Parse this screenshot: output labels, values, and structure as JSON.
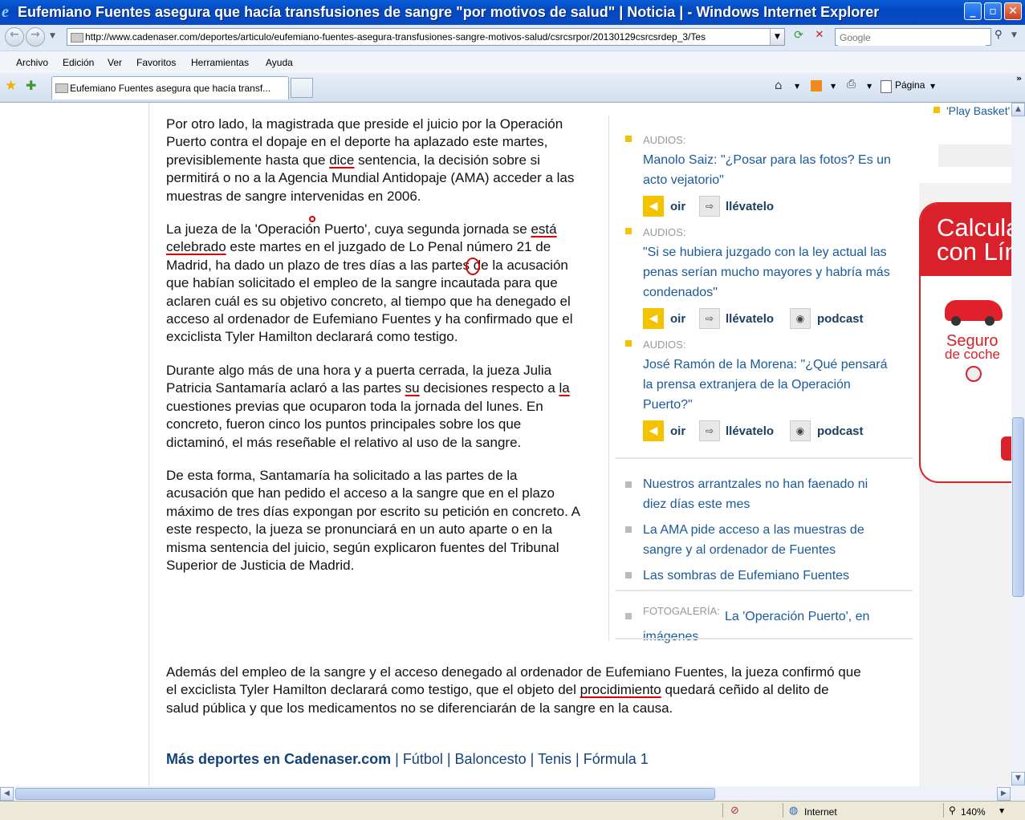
{
  "window": {
    "title": "Eufemiano Fuentes asegura que hacía transfusiones de sangre \"por motivos de salud\" | Noticia |  - Windows Internet Explorer"
  },
  "address_bar": {
    "url": "http://www.cadenaser.com/deportes/articulo/eufemiano-fuentes-asegura-transfusiones-sangre-motivos-salud/csrcsrpor/20130129csrcsrdep_3/Tes",
    "search_placeholder": "Google"
  },
  "menu": [
    "Archivo",
    "Edición",
    "Ver",
    "Favoritos",
    "Herramientas",
    "Ayuda"
  ],
  "tab": {
    "label": "Eufemiano Fuentes asegura que hacía transf..."
  },
  "toolbar": {
    "page_label": "Página"
  },
  "article": {
    "p1": "Por otro lado, la magistrada que preside el juicio por la Operación Puerto contra el dopaje en el deporte ha aplazado este martes, previsiblemente hasta que dice sentencia, la decisión sobre si permitirá o no a la Agencia Mundial Antidopaje (AMA) acceder a las muestras de sangre intervenidas en 2006.",
    "p2": "La jueza de la 'Operación Puerto', cuya segunda jornada se está celebrado este martes en el juzgado de Lo Penal número 21 de Madrid, ha dado un plazo de tres días a las partes de la acusación que habían solicitado el empleo de la sangre incautada para que aclaren cuál es su objetivo concreto, al tiempo que ha denegado el acceso al ordenador de Eufemiano Fuentes y ha confirmado que el exciclista Tyler Hamilton declarará como testigo.",
    "p3": "Durante algo más de una hora y a puerta cerrada, la jueza Julia Patricia Santamaría aclaró a las partes su decisiones respecto a la cuestiones previas que ocuparon toda la jornada del lunes. En concreto, fueron cinco los puntos principales sobre los que dictaminó, el más reseñable el relativo al uso de la sangre.",
    "p4": "De esta forma, Santamaría ha solicitado a las partes de la acusación que han pedido el acceso a la sangre que en el plazo máximo de tres días expongan por escrito su petición en concreto. A este respecto, la jueza se pronunciará en un auto aparte o en la misma sentencia del juicio, según explicaron fuentes del Tribunal Superior de Justicia de Madrid.",
    "p5": "Además del empleo de la sangre y el acceso denegado al ordenador de Eufemiano Fuentes, la jueza confirmó que el exciclista Tyler Hamilton declarará como testigo, que el objeto del procidimiento quedará ceñido al delito de salud pública y que los medicamentos no se diferenciarán de la sangre en la causa."
  },
  "more": {
    "label": "Más deportes en Cadenaser.com",
    "links": [
      "Fútbol",
      "Baloncesto",
      "Tenis",
      "Fórmula 1"
    ]
  },
  "sidebar": {
    "audios": [
      {
        "kicker": "AUDIOS:",
        "title": "Manolo Saiz: \"¿Posar para las fotos? Es un acto vejatorio\"",
        "oir": "oir",
        "llevatelo": "llévatelo"
      },
      {
        "kicker": "AUDIOS:",
        "title": "\"Si se hubiera juzgado con la ley actual las penas serían mucho mayores y habría más condenados\"",
        "oir": "oir",
        "llevatelo": "llévatelo",
        "podcast": "podcast"
      },
      {
        "kicker": "AUDIOS:",
        "title": "José Ramón de la Morena: \"¿Qué pensará la prensa extranjera de la Operación Puerto?\"",
        "oir": "oir",
        "llevatelo": "llévatelo",
        "podcast": "podcast"
      }
    ],
    "related": [
      "Nuestros arrantzales no han faenado ni diez días este mes",
      "La AMA pide acceso a las muestras de sangre y al ordenador de Fuentes",
      "Las sombras de Eufemiano Fuentes"
    ],
    "gallery_kicker": "FOTOGALERÍA:",
    "gallery_title": "La 'Operación Puerto', en imágenes"
  },
  "right": {
    "top_link": "'Play Basket'",
    "ad_line1": "Calcula",
    "ad_line2": "con Lín",
    "ad_product1": "Seguro",
    "ad_product2": "de coche"
  },
  "status": {
    "zone": "Internet",
    "zoom": "140%"
  },
  "colors": {
    "title_bar": "#0a5fd8",
    "link": "#1a5a9a",
    "accent": "#f4c300",
    "ad_red": "#d8212a"
  }
}
